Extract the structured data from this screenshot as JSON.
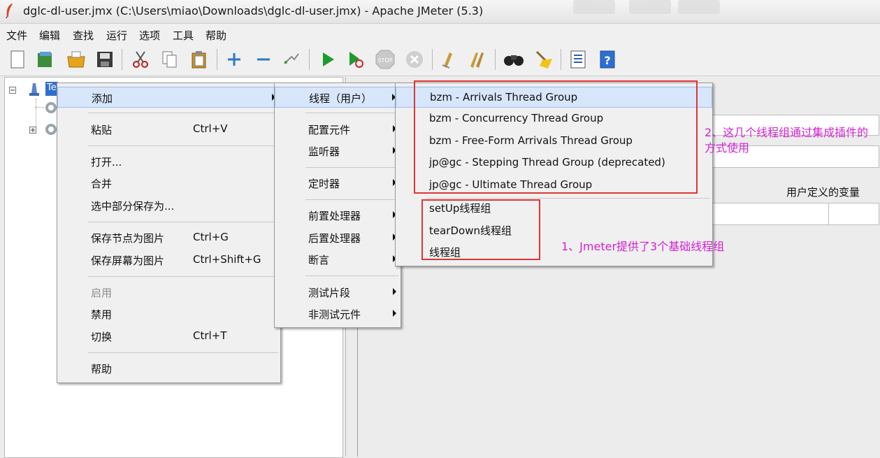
{
  "window": {
    "title": "dglc-dl-user.jmx (C:\\Users\\miao\\Downloads\\dglc-dl-user.jmx) - Apache JMeter (5.3)"
  },
  "menubar": {
    "items": [
      "文件",
      "编辑",
      "查找",
      "运行",
      "选项",
      "工具",
      "帮助"
    ]
  },
  "toolbar": {
    "icons": [
      "new-icon",
      "templates-icon",
      "open-icon",
      "save-icon",
      "cut-icon",
      "copy-icon",
      "paste-icon",
      "expand-icon",
      "collapse-icon",
      "toggle-icon",
      "start-icon",
      "start-no-pause-icon",
      "stop-icon",
      "shutdown-icon",
      "clear-icon",
      "clear-all-icon",
      "search-icon",
      "reset-search-icon",
      "function-helper-icon",
      "help-icon"
    ]
  },
  "tree": {
    "root_label": "Te"
  },
  "context_menu": {
    "items": [
      {
        "label": "添加",
        "shortcut": "",
        "submenu": true,
        "selected": true
      },
      {
        "label": "粘贴",
        "shortcut": "Ctrl+V"
      },
      {
        "label": "打开...",
        "shortcut": ""
      },
      {
        "label": "合并",
        "shortcut": ""
      },
      {
        "label": "选中部分保存为...",
        "shortcut": ""
      },
      {
        "label": "保存节点为图片",
        "shortcut": "Ctrl+G"
      },
      {
        "label": "保存屏幕为图片",
        "shortcut": "Ctrl+Shift+G"
      },
      {
        "label": "启用",
        "shortcut": "",
        "disabled": true
      },
      {
        "label": "禁用",
        "shortcut": ""
      },
      {
        "label": "切换",
        "shortcut": "Ctrl+T"
      },
      {
        "label": "帮助",
        "shortcut": ""
      }
    ]
  },
  "add_submenu": {
    "items": [
      "线程（用户）",
      "配置元件",
      "监听器",
      "定时器",
      "前置处理器",
      "后置处理器",
      "断言",
      "测试片段",
      "非测试元件"
    ]
  },
  "threads_submenu": {
    "plugin_items": [
      "bzm - Arrivals Thread Group",
      "bzm - Concurrency Thread Group",
      "bzm - Free-Form Arrivals Thread Group",
      "jp@gc - Stepping Thread Group (deprecated)",
      "jp@gc - Ultimate Thread Group"
    ],
    "basic_items": [
      "setUp线程组",
      "tearDown线程组",
      "线程组"
    ]
  },
  "right_panel": {
    "user_vars_label": "用户定义的变量"
  },
  "annotations": {
    "plugins_note": "2、这几个线程组通过集成插件的方式使用",
    "basic_note": "1、Jmeter提供了3个基础线程组"
  },
  "colors": {
    "annotation": "#d21fd2",
    "highlight_box": "#e03434",
    "menu_selection": "#d7e6fb"
  }
}
